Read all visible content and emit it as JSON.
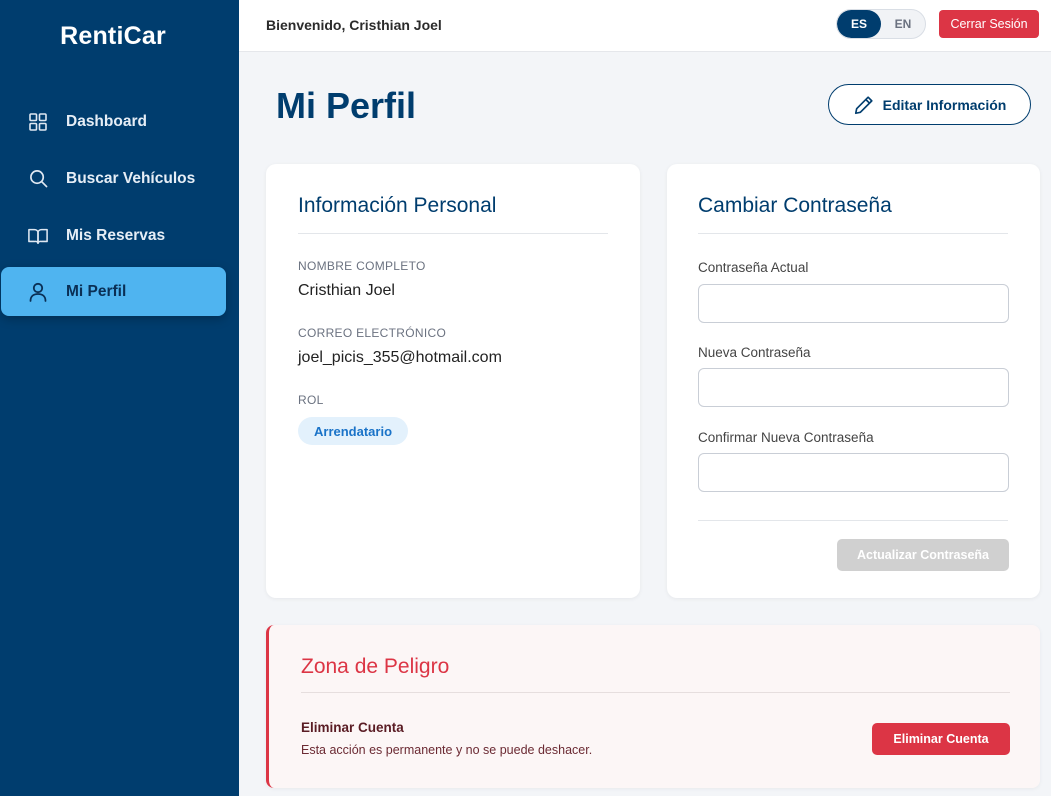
{
  "sidebar": {
    "brand": "RentiCar",
    "items": [
      {
        "label": "Dashboard",
        "icon": "dashboard-grid-icon"
      },
      {
        "label": "Buscar Vehículos",
        "icon": "search-icon"
      },
      {
        "label": "Mis Reservas",
        "icon": "book-icon"
      },
      {
        "label": "Mi Perfil",
        "icon": "user-icon",
        "active": true
      }
    ]
  },
  "topbar": {
    "welcome": "Bienvenido, Cristhian Joel",
    "lang_es": "ES",
    "lang_en": "EN",
    "logout": "Cerrar Sesión"
  },
  "header": {
    "title": "Mi Perfil",
    "edit_label": "Editar Información"
  },
  "personal": {
    "title": "Información Personal",
    "name_label": "Nombre Completo",
    "name_value": "Cristhian Joel",
    "email_label": "Correo Electrónico",
    "email_value": "joel_picis_355@hotmail.com",
    "role_label": "Rol",
    "role_value": "Arrendatario"
  },
  "password": {
    "title": "Cambiar Contraseña",
    "current_label": "Contraseña Actual",
    "new_label": "Nueva Contraseña",
    "confirm_label": "Confirmar Nueva Contraseña",
    "submit_label": "Actualizar Contraseña"
  },
  "danger": {
    "title": "Zona de Peligro",
    "subtitle": "Eliminar Cuenta",
    "text": "Esta acción es permanente y no se puede deshacer.",
    "button": "Eliminar Cuenta"
  },
  "colors": {
    "sidebar": "#003d6e",
    "active": "#4fb4f0",
    "danger": "#dc3545"
  }
}
